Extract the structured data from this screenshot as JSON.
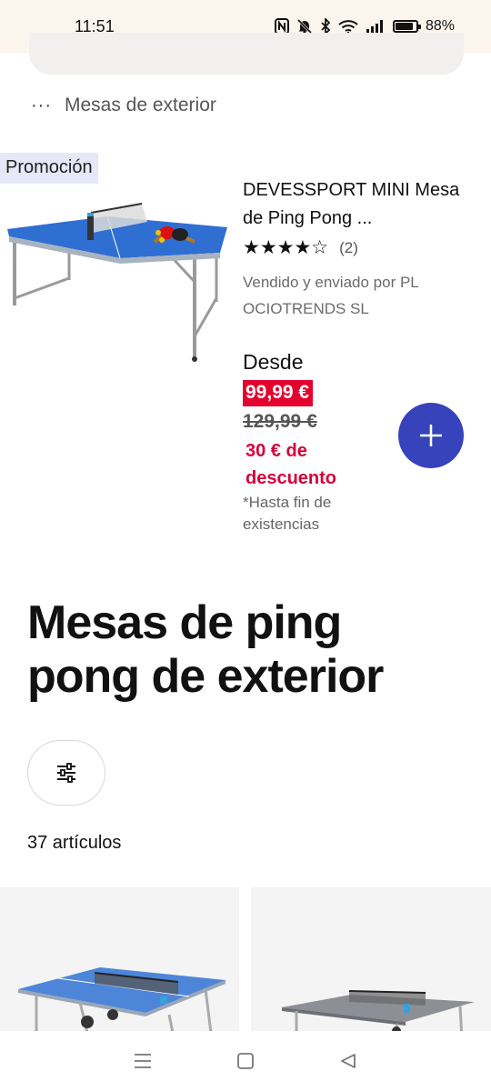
{
  "status_bar": {
    "time": "11:51",
    "battery": "88%",
    "battery_level": 0.88,
    "icons": [
      "nfc-icon",
      "bell-muted-icon",
      "bluetooth-icon",
      "wifi-icon",
      "signal-icon",
      "battery-icon"
    ]
  },
  "breadcrumb": {
    "dots": "···",
    "label": "Mesas de exterior"
  },
  "promo_product": {
    "badge": "Promoción",
    "title": "DEVESSPORT MINI Mesa de Ping Pong ...",
    "stars": "★★★★☆",
    "rating": 4,
    "review_count": "(2)",
    "seller": "Vendido y enviado por PL OCIOTRENDS SL",
    "from_label": "Desde",
    "price": "99,99 €",
    "old_price": "129,99 €",
    "discount": "30 € de descuento",
    "availability_note": "*Hasta fin de existencias"
  },
  "section": {
    "title": "Mesas de ping pong de exterior",
    "article_count": "37 artículos"
  },
  "colors": {
    "accent": "#3643ba",
    "price_red": "#e4032e",
    "discount_red": "#d6003a",
    "promo_badge_bg": "#e5e9f7",
    "status_bar_bg": "#fbf5ee"
  },
  "nav_bar": {
    "icons": [
      "menu-icon",
      "home-square-icon",
      "back-triangle-icon"
    ]
  }
}
